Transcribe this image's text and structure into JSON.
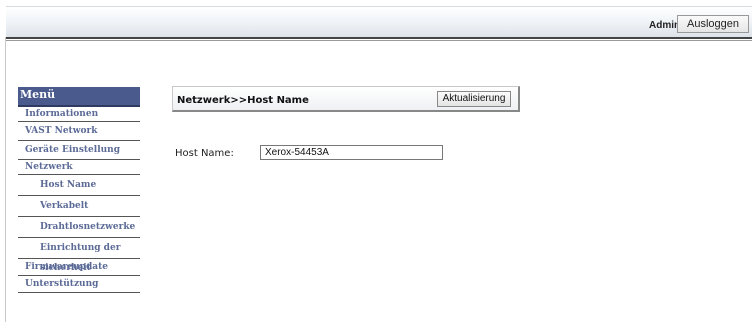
{
  "header": {
    "user": "Admin",
    "logout_label": "Ausloggen"
  },
  "menu": {
    "title": "Menü",
    "items": [
      {
        "label": "Informationen"
      },
      {
        "label": "VAST Network"
      },
      {
        "label": "Geräte Einstellung"
      },
      {
        "label": "Netzwerk"
      },
      {
        "label": "Host Name"
      },
      {
        "label": "Verkabelt"
      },
      {
        "label": "Drahtlosnetzwerke"
      },
      {
        "label": "Einrichtung der sicherheit"
      },
      {
        "label": "Firmwareupdate"
      },
      {
        "label": "Unterstützung"
      }
    ]
  },
  "main": {
    "breadcrumb": "Netzwerk>>Host Name",
    "refresh_label": "Aktualisierung",
    "host_name_label": "Host Name:",
    "host_name_value": "Xerox-54453A"
  }
}
